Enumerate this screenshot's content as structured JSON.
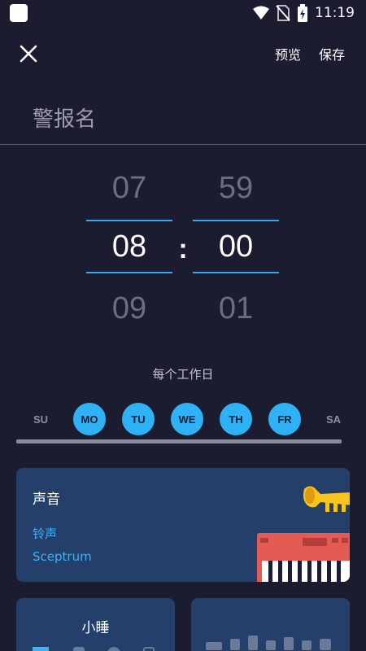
{
  "status_bar": {
    "time": "11:19",
    "icons": [
      "app-square-icon",
      "wifi-icon",
      "no-sim-icon",
      "battery-charging-icon"
    ]
  },
  "top_bar": {
    "close_icon": "close-icon",
    "preview_label": "预览",
    "save_label": "保存"
  },
  "alarm_name": {
    "placeholder": "警报名",
    "value": ""
  },
  "time_picker": {
    "hour": {
      "prev": "07",
      "selected": "08",
      "next": "09"
    },
    "minute": {
      "prev": "59",
      "selected": "00",
      "next": "01"
    },
    "separator": ":"
  },
  "repeat": {
    "label": "每个工作日",
    "days": [
      {
        "label": "SU",
        "selected": false
      },
      {
        "label": "MO",
        "selected": true
      },
      {
        "label": "TU",
        "selected": true
      },
      {
        "label": "WE",
        "selected": true
      },
      {
        "label": "TH",
        "selected": true
      },
      {
        "label": "FR",
        "selected": true
      },
      {
        "label": "SA",
        "selected": false
      }
    ]
  },
  "sound_card": {
    "title": "声音",
    "ringtone_label": "铃声",
    "ringtone_value": "Sceptrum",
    "illustration": [
      "trumpet-icon",
      "keyboard-icon"
    ]
  },
  "snooze_card": {
    "title": "小睡"
  },
  "colors": {
    "background": "#1b1c30",
    "accent": "#2fb2f5",
    "card": "#243f69"
  }
}
